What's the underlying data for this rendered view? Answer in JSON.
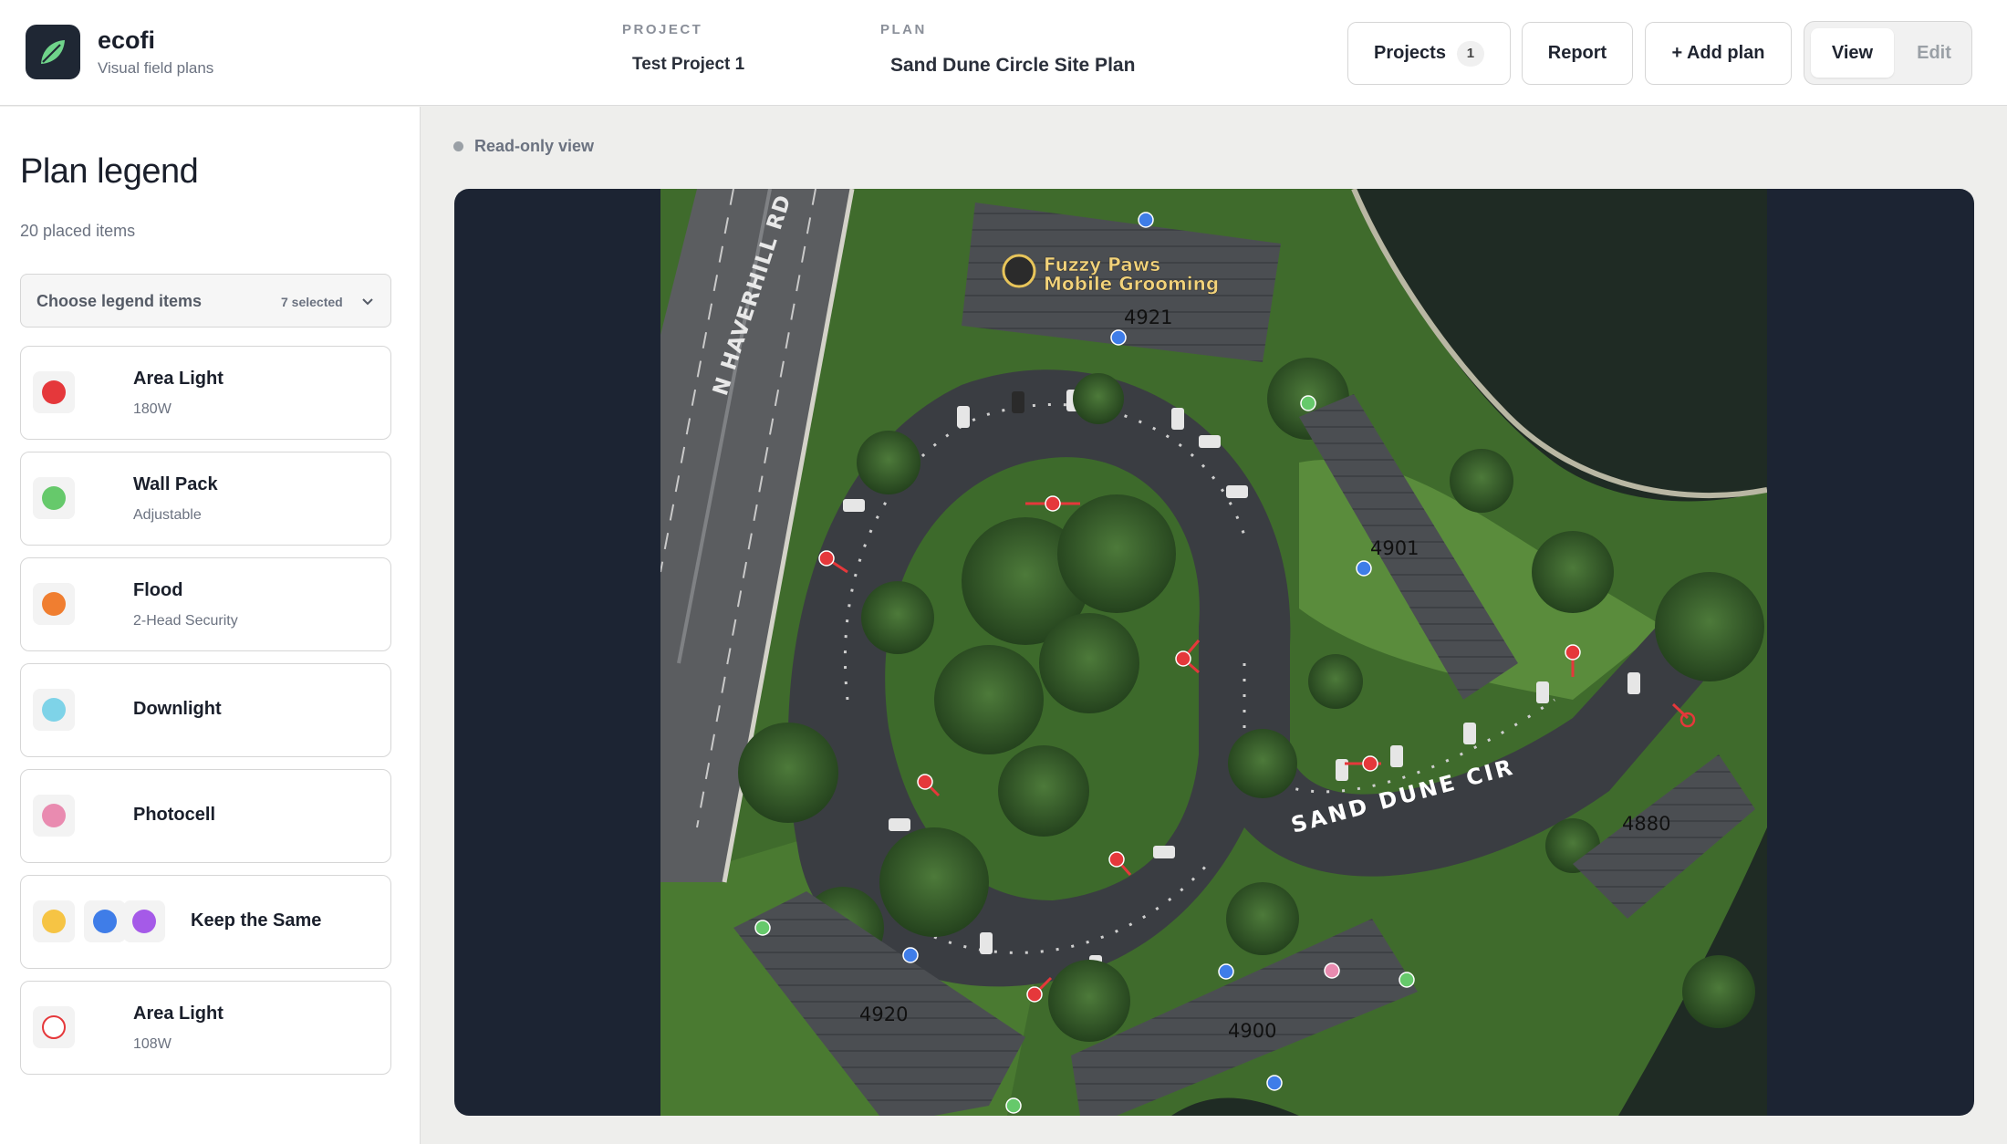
{
  "app": {
    "name": "ecofi",
    "tagline": "Visual field plans"
  },
  "header": {
    "project_label": "PROJECT",
    "project_value": "Test Project 1",
    "plan_label": "PLAN",
    "plan_value": "Sand Dune Circle Site Plan",
    "buttons": {
      "projects": "Projects",
      "projects_count": "1",
      "report": "Report",
      "add_plan": "+ Add plan"
    },
    "mode": {
      "view": "View",
      "edit": "Edit",
      "active": "View"
    }
  },
  "sidebar": {
    "title": "Plan legend",
    "placed_count": "20 placed items",
    "dropdown": {
      "label": "Choose legend items",
      "selected": "7 selected"
    },
    "items": [
      {
        "name": "Area Light",
        "sub": "180W",
        "color": "#e5383b"
      },
      {
        "name": "Wall Pack",
        "sub": "Adjustable",
        "color": "#66c96b"
      },
      {
        "name": "Flood",
        "sub": "2-Head Security",
        "color": "#f07e30"
      },
      {
        "name": "Downlight",
        "sub": "",
        "color": "#7ed3e8"
      },
      {
        "name": "Photocell",
        "sub": "",
        "color": "#e98bb0"
      },
      {
        "name": "Keep the Same",
        "sub": "",
        "colors": [
          "#f6c444",
          "#3f7de8",
          "#a55ae8"
        ]
      },
      {
        "name": "Area Light",
        "sub": "108W",
        "color": "#e5383b",
        "style": "ring"
      }
    ]
  },
  "view": {
    "status": "Read-only view"
  },
  "map": {
    "road_label": "N HAVERHILL RD",
    "street_label": "SAND DUNE CIR",
    "poi": [
      "Fuzzy Paws",
      "Mobile Grooming"
    ],
    "building_labels": [
      "4921",
      "4901",
      "4880",
      "4920",
      "4900"
    ],
    "colors": {
      "area_light": "#e5383b",
      "wall_pack": "#66c96b",
      "keep_same_blue": "#3f7de8",
      "photocell": "#e98bb0"
    }
  }
}
